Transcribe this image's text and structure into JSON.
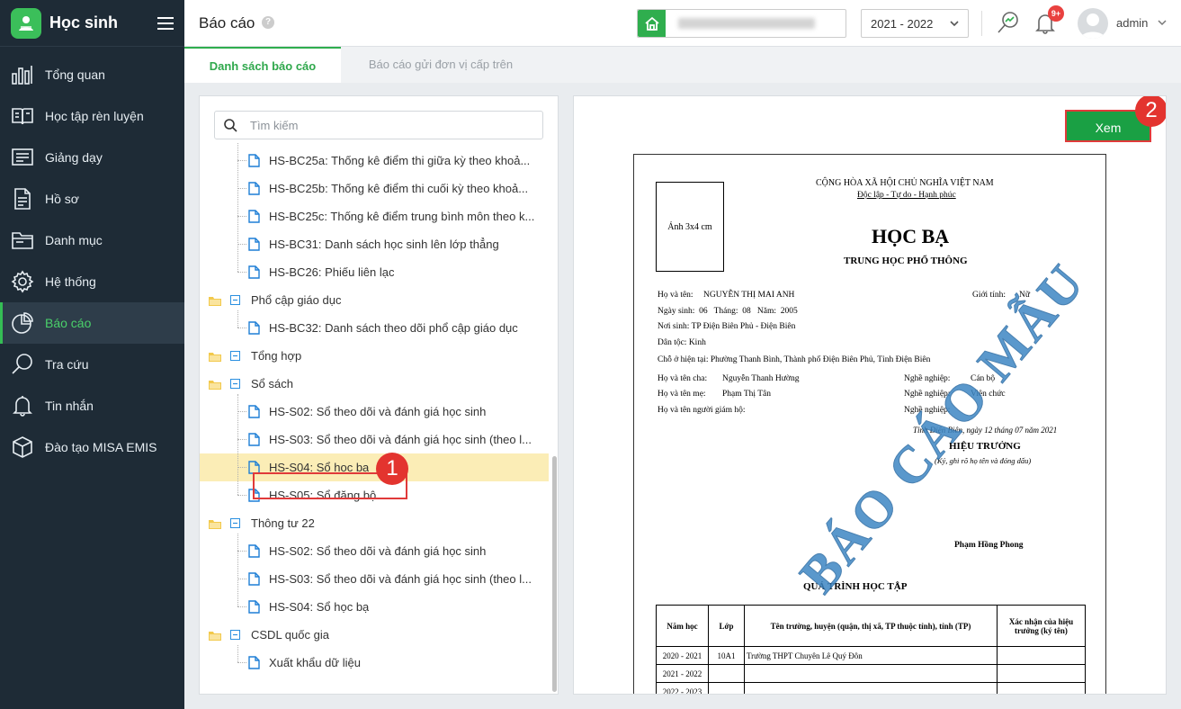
{
  "app": {
    "title": "Học sinh"
  },
  "sidebar": {
    "items": [
      {
        "label": "Tổng quan",
        "icon": "bar-chart-icon"
      },
      {
        "label": "Học tập rèn luyện",
        "icon": "book-icon"
      },
      {
        "label": "Giảng dạy",
        "icon": "board-icon"
      },
      {
        "label": "Hồ sơ",
        "icon": "document-icon"
      },
      {
        "label": "Danh mục",
        "icon": "folder-icon"
      },
      {
        "label": "Hệ thống",
        "icon": "gear-icon"
      },
      {
        "label": "Báo cáo",
        "icon": "pie-chart-icon",
        "active": true
      },
      {
        "label": "Tra cứu",
        "icon": "search-icon"
      },
      {
        "label": "Tin nhắn",
        "icon": "bell-icon"
      },
      {
        "label": "Đào tạo MISA EMIS",
        "icon": "box-icon"
      }
    ]
  },
  "header": {
    "page_title": "Báo cáo",
    "help": "?",
    "year": "2021 - 2022",
    "notif_badge": "9+",
    "username": "admin"
  },
  "tabs": [
    {
      "label": "Danh sách báo cáo",
      "active": true
    },
    {
      "label": "Báo cáo gửi đơn vị cấp trên",
      "active": false
    }
  ],
  "search": {
    "placeholder": "Tìm kiếm"
  },
  "tree": [
    {
      "type": "file",
      "label": "HS-BC25a: Thống kê điểm thi giữa kỳ theo khoả..."
    },
    {
      "type": "file",
      "label": "HS-BC25b: Thống kê điểm thi cuối kỳ theo khoả..."
    },
    {
      "type": "file",
      "label": "HS-BC25c: Thống kê điểm trung bình môn theo k..."
    },
    {
      "type": "file",
      "label": "HS-BC31: Danh sách học sinh lên lớp thẳng"
    },
    {
      "type": "file",
      "label": "HS-BC26: Phiếu liên lạc"
    },
    {
      "type": "folder",
      "label": "Phổ cập giáo dục"
    },
    {
      "type": "file",
      "label": "HS-BC32: Danh sách theo dõi phổ cập giáo dục"
    },
    {
      "type": "folder",
      "label": "Tổng hợp"
    },
    {
      "type": "folder",
      "label": "Sổ sách"
    },
    {
      "type": "file",
      "label": "HS-S02: Sổ theo dõi và đánh giá học sinh"
    },
    {
      "type": "file",
      "label": "HS-S03: Sổ theo dõi và đánh giá học sinh (theo l..."
    },
    {
      "type": "file",
      "label": "HS-S04: Sổ học bạ",
      "selected": true
    },
    {
      "type": "file",
      "label": "HS-S05: Sổ đăng bộ"
    },
    {
      "type": "folder",
      "label": "Thông tư 22"
    },
    {
      "type": "file",
      "label": "HS-S02: Sổ theo dõi và đánh giá học sinh"
    },
    {
      "type": "file",
      "label": "HS-S03: Sổ theo dõi và đánh giá học sinh (theo l..."
    },
    {
      "type": "file",
      "label": "HS-S04: Sổ học bạ"
    },
    {
      "type": "folder",
      "label": "CSDL quốc gia"
    },
    {
      "type": "file",
      "label": "Xuất khẩu dữ liệu"
    }
  ],
  "view_button": "Xem",
  "callouts": [
    "1",
    "2"
  ],
  "preview": {
    "nation": "CỘNG HÒA XÃ HỘI CHỦ NGHĨA VIỆT NAM",
    "motto": "Độc lập - Tự do - Hạnh phúc",
    "photo": "Ảnh 3x4 cm",
    "title": "HỌC BẠ",
    "subtitle": "TRUNG HỌC PHỔ THÔNG",
    "name_label": "Họ và tên:",
    "name": "NGUYỄN THỊ MAI ANH",
    "gender_label": "Giới tính:",
    "gender": "Nữ",
    "dob": "Ngày sinh:  06   Tháng:  08   Năm:  2005",
    "birthplace": "Nơi sinh:  TP Điện Biên Phủ - Điện Biên",
    "ethnic": "Dân tộc: Kinh",
    "address": "Chỗ ở hiện tại:  Phường Thanh Bình, Thành phố Điện Biên Phủ, Tỉnh Điện Biên",
    "father_label": "Họ và tên cha:",
    "father": "Nguyễn Thanh Hường",
    "job_label": "Nghề nghiệp:",
    "father_job": "Cán bộ",
    "mother_label": "Họ và tên mẹ:",
    "mother": "Phạm Thị Tân",
    "mother_job": "Viên chức",
    "guardian_label": "Họ và tên người giám hộ:",
    "date_line": "Tỉnh Điện Biên, ngày 12 tháng 07 năm 2021",
    "principal_title": "HIỆU TRƯỞNG",
    "principal_note": "(Ký, ghi rõ họ tên và đóng dấu)",
    "principal_name": "Phạm Hồng Phong",
    "watermark": "BÁO CÁO MẪU",
    "section": "QUÁ TRÌNH HỌC TẬP",
    "table_headers": [
      "Năm học",
      "Lớp",
      "Tên trường, huyện (quận, thị xã, TP thuộc tỉnh), tỉnh (TP)",
      "Xác nhận của hiệu trưởng (ký tên)"
    ],
    "table_rows": [
      [
        "2020 - 2021",
        "10A1",
        "Trường THPT Chuyên Lê Quý Đôn",
        ""
      ],
      [
        "2021 - 2022",
        "",
        "",
        ""
      ],
      [
        "2022 - 2023",
        "",
        "",
        ""
      ]
    ]
  },
  "colors": {
    "sidebar": "#1e2b36",
    "accent": "#2fae4e",
    "callout": "#e3342f",
    "selected_row": "#fbedb6",
    "watermark": "#3e87c4"
  }
}
